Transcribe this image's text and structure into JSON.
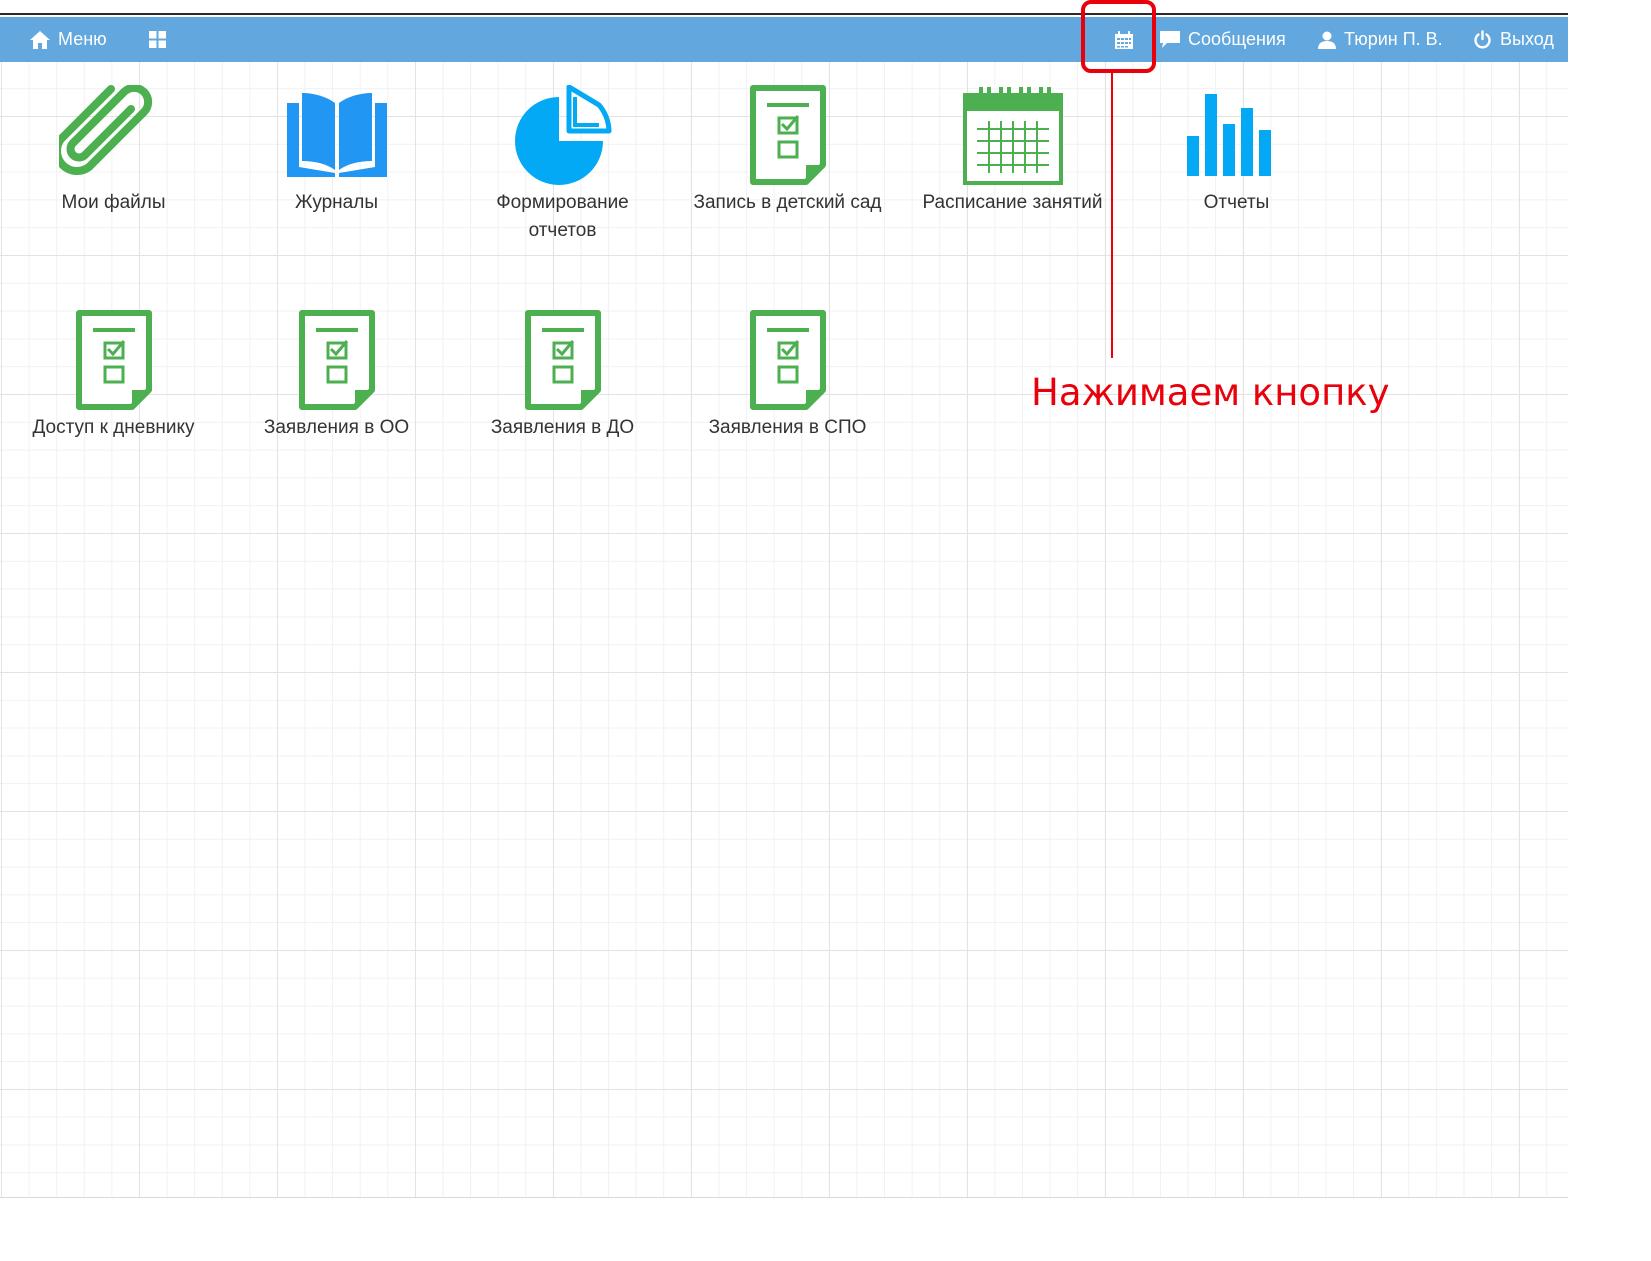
{
  "navbar": {
    "menu_label": "Меню",
    "messages_label": "Сообщения",
    "user_label": "Тюрин П. В.",
    "exit_label": "Выход"
  },
  "tiles": [
    {
      "label": "Мои файлы",
      "icon": "paperclip-icon"
    },
    {
      "label": "Журналы",
      "icon": "book-icon"
    },
    {
      "label": "Формирование отчетов",
      "icon": "pie-chart-icon"
    },
    {
      "label": "Запись в детский сад",
      "icon": "checklist-document-icon"
    },
    {
      "label": "Расписание занятий",
      "icon": "calendar-icon"
    },
    {
      "label": "Отчеты",
      "icon": "bar-chart-icon"
    },
    {
      "label": "Доступ к дневнику",
      "icon": "checklist-document-icon"
    },
    {
      "label": "Заявления в ОО",
      "icon": "checklist-document-icon"
    },
    {
      "label": "Заявления в ДО",
      "icon": "checklist-document-icon"
    },
    {
      "label": "Заявления в СПО",
      "icon": "checklist-document-icon"
    }
  ],
  "annotation": {
    "text": "Нажимаем кнопку"
  },
  "colors": {
    "navbar": "#62a8de",
    "green_icon": "#4caf50",
    "blue_icon": "#2196f3",
    "annotation": "#e8000b"
  }
}
